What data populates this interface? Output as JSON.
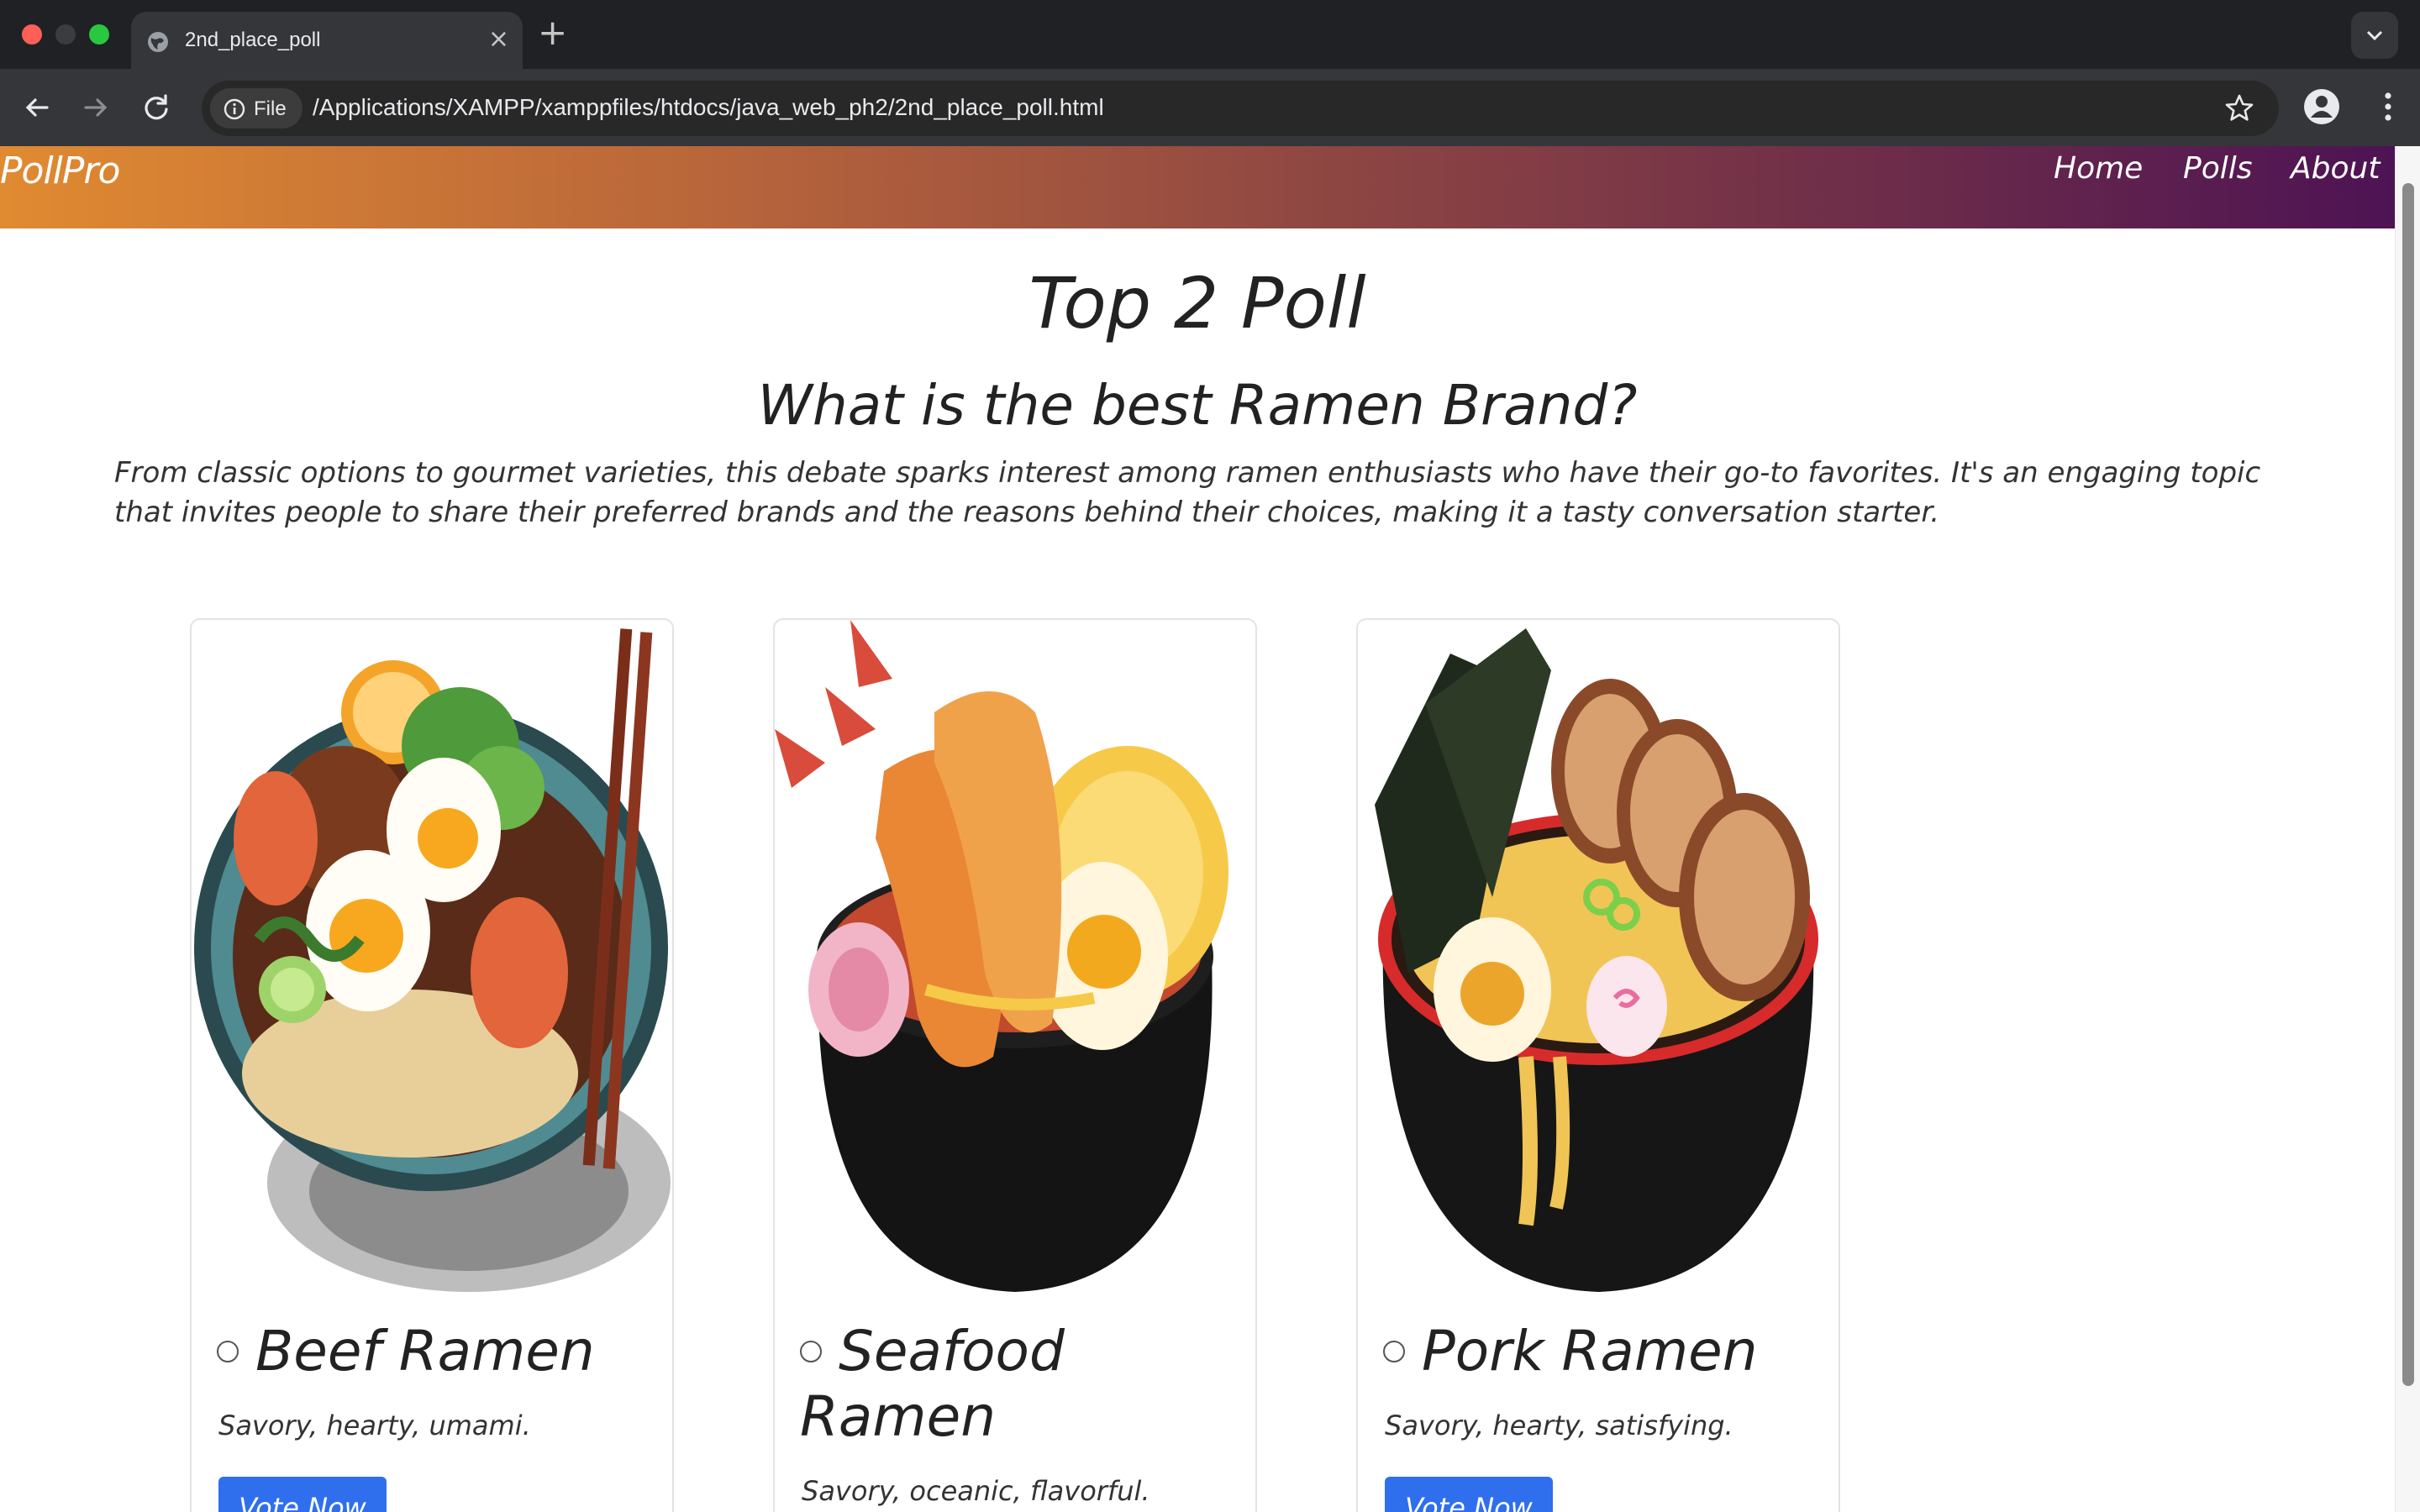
{
  "browser": {
    "tab_title": "2nd_place_poll",
    "chip_label": "File",
    "url": "/Applications/XAMPP/xamppfiles/htdocs/java_web_ph2/2nd_place_poll.html",
    "new_tab_glyph": "+",
    "close_glyph": "×"
  },
  "site": {
    "brand": "PollPro",
    "nav": {
      "home": "Home",
      "polls": "Polls",
      "about": "About"
    },
    "gradient_colors": [
      "#e08a31",
      "#4d1354"
    ]
  },
  "poll": {
    "title": "Top 2 Poll",
    "question": "What is the best Ramen Brand?",
    "description": "From classic options to gourmet varieties, this debate sparks interest among ramen enthusiasts who have their go-to favorites. It's an engaging topic that invites people to share their preferred brands and the reasons behind their choices, making it a tasty conversation starter."
  },
  "options": [
    {
      "name": "Beef Ramen",
      "tagline": "Savory, hearty, umami.",
      "vote_label": "Vote Now",
      "image": "beef-ramen-bowl"
    },
    {
      "name": "Seafood Ramen",
      "tagline": "Savory, oceanic, flavorful.",
      "vote_label": "Vote Now",
      "image": "seafood-ramen-bowl"
    },
    {
      "name": "Pork Ramen",
      "tagline": "Savory, hearty, satisfying.",
      "vote_label": "Vote Now",
      "image": "pork-ramen-bowl"
    }
  ],
  "colors": {
    "accent_button": "#2f6fee",
    "chrome_dark": "#202124"
  }
}
